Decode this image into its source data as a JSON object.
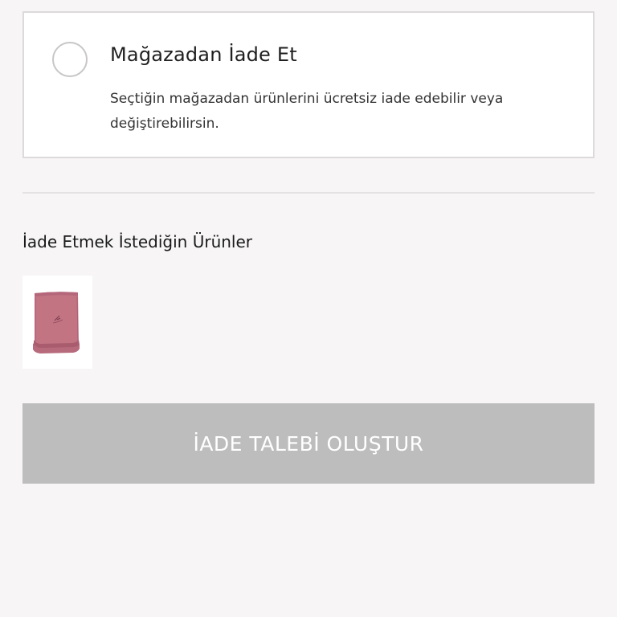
{
  "store_return_option": {
    "title": "Mağazadan İade Et",
    "description": "Seçtiğin mağazadan ürünlerini ücretsiz iade edebilir veya değiştirebilirsin.",
    "selected": false
  },
  "products_section": {
    "title": "İade Etmek İstediğin Ürünler",
    "items": [
      {
        "image": "pink-folded-towel",
        "color": "#c27483"
      }
    ]
  },
  "submit": {
    "label": "İADE TALEBİ OLUŞTUR",
    "enabled": false,
    "color": "#bdbdbd"
  }
}
